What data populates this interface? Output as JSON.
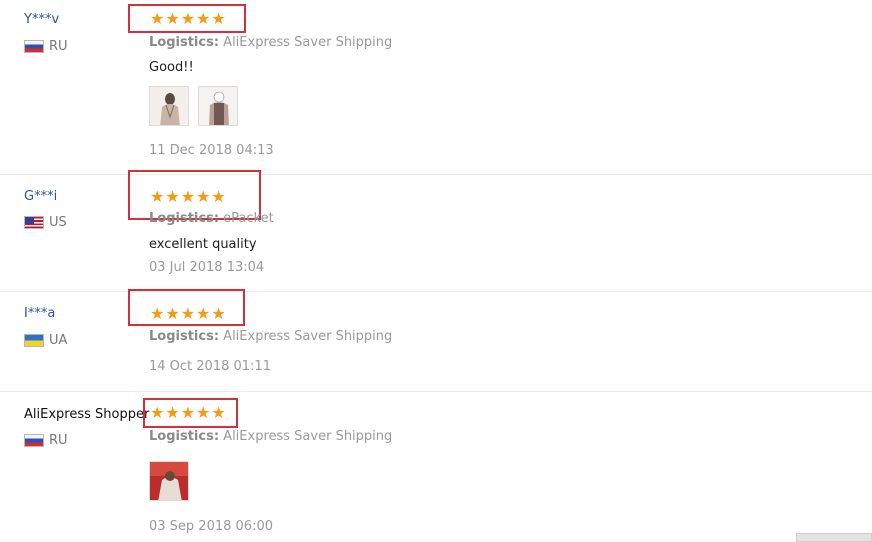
{
  "reviews": [
    {
      "user": "Y***v",
      "country": "RU",
      "flag_icon": "russia-flag-icon",
      "stars": "★★★★★",
      "rating": 5,
      "logistics_label": "Logistics:",
      "logistics_value": "AliExpress Saver Shipping",
      "comment": "Good!!",
      "photo_count": 2,
      "date": "11 Dec 2018 04:13"
    },
    {
      "user": "G***i",
      "country": "US",
      "flag_icon": "usa-flag-icon",
      "stars": "★★★★★",
      "rating": 5,
      "logistics_label": "Logistics:",
      "logistics_value": "ePacket",
      "comment": "excellent quality",
      "photo_count": 0,
      "date": "03 Jul 2018 13:04"
    },
    {
      "user": "I***a",
      "country": "UA",
      "flag_icon": "ukraine-flag-icon",
      "stars": "★★★★★",
      "rating": 5,
      "logistics_label": "Logistics:",
      "logistics_value": "AliExpress Saver Shipping",
      "comment": "",
      "photo_count": 0,
      "date": "14 Oct 2018 01:11"
    },
    {
      "user": "AliExpress Shopper",
      "country": "RU",
      "flag_icon": "russia-flag-icon",
      "stars": "★★★★★",
      "rating": 5,
      "logistics_label": "Logistics:",
      "logistics_value": "AliExpress Saver Shipping",
      "comment": "",
      "photo_count": 1,
      "date": "03 Sep 2018 06:00"
    }
  ],
  "colors": {
    "star": "#f39b17",
    "highlight_box": "#d0313c",
    "username_link": "#2a55a3"
  }
}
